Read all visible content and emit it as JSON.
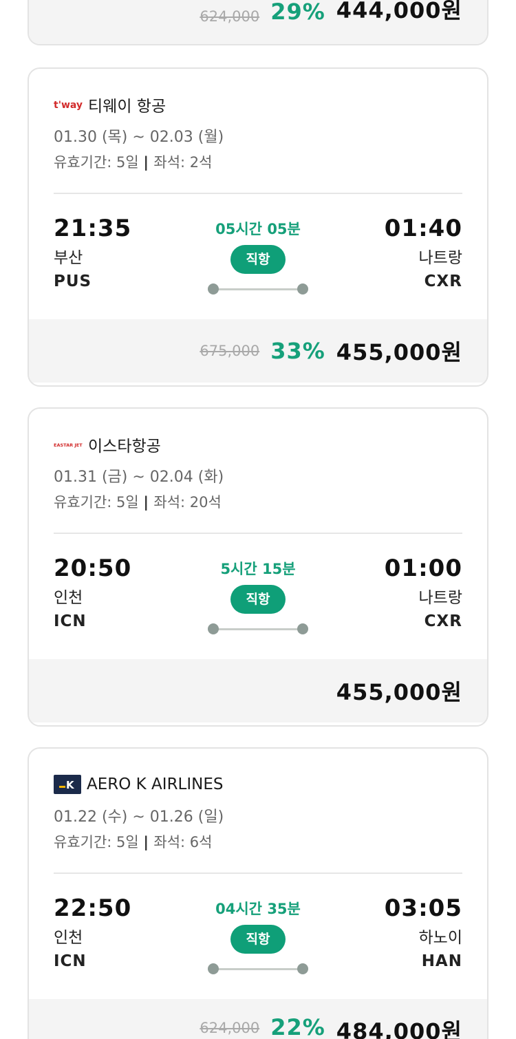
{
  "cards": [
    {
      "price": {
        "original": "624,000",
        "discount": "29%",
        "final": "444,000원"
      }
    },
    {
      "airline": {
        "logo_text": "t'way",
        "logo_color": "#d22b2b",
        "name": "티웨이 항공"
      },
      "dates": "01.30 (목) ~ 02.03 (월)",
      "validity": {
        "label": "유효기간: 5일",
        "seats": "좌석: 2석"
      },
      "departure": {
        "time": "21:35",
        "city": "부산",
        "code": "PUS"
      },
      "arrival": {
        "time": "01:40",
        "city": "나트랑",
        "code": "CXR"
      },
      "duration": "05시간 05분",
      "direct_label": "직항",
      "price": {
        "original": "675,000",
        "discount": "33%",
        "final": "455,000원"
      }
    },
    {
      "airline": {
        "logo_text": "EASTAR JET",
        "logo_color": "#d22b2b",
        "name": "이스타항공"
      },
      "dates": "01.31 (금) ~ 02.04 (화)",
      "validity": {
        "label": "유효기간: 5일",
        "seats": "좌석: 20석"
      },
      "departure": {
        "time": "20:50",
        "city": "인천",
        "code": "ICN"
      },
      "arrival": {
        "time": "01:00",
        "city": "나트랑",
        "code": "CXR"
      },
      "duration": "5시간 15분",
      "direct_label": "직항",
      "price": {
        "original": "",
        "discount": "",
        "final": "455,000원"
      }
    },
    {
      "airline": {
        "logo_text": "K",
        "logo_color": "#1b2a4a",
        "name": "AERO K AIRLINES"
      },
      "dates": "01.22 (수) ~ 01.26 (일)",
      "validity": {
        "label": "유효기간: 5일",
        "seats": "좌석: 6석"
      },
      "departure": {
        "time": "22:50",
        "city": "인천",
        "code": "ICN"
      },
      "arrival": {
        "time": "03:05",
        "city": "하노이",
        "code": "HAN"
      },
      "duration": "04시간 35분",
      "direct_label": "직항",
      "price": {
        "original": "624,000",
        "discount": "22%",
        "final": "484,000원"
      }
    }
  ],
  "colors": {
    "accent": "#0f9f78",
    "accent_text": "#16a07a",
    "strike": "#a9a9a9"
  }
}
